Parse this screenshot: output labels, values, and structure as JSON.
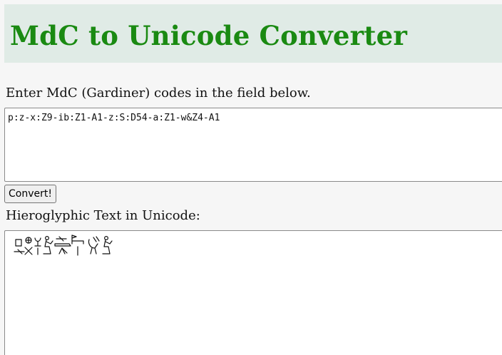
{
  "header": {
    "title": "MdC to Unicode Converter"
  },
  "input_section": {
    "instruction": "Enter MdC (Gardiner) codes in the field below.",
    "mdc_value": "p:z-x:Z9-ib:Z1-A1-z:S:D54-a:Z1-w&Z4-A1",
    "convert_label": "Convert!"
  },
  "output_section": {
    "label": "Hieroglyphic Text in Unicode:",
    "glyph_sequence": [
      "p-over-z",
      "x-over-Z9",
      "ib-over-Z1",
      "A1-seated-man",
      "z-over-S-over-D54",
      "a-over-Z1",
      "w-ligature-Z4",
      "A1-seated-man"
    ]
  },
  "colors": {
    "header_background": "#e0ebe6",
    "title_color": "#1a8a12",
    "page_background": "#f6f6f6"
  }
}
